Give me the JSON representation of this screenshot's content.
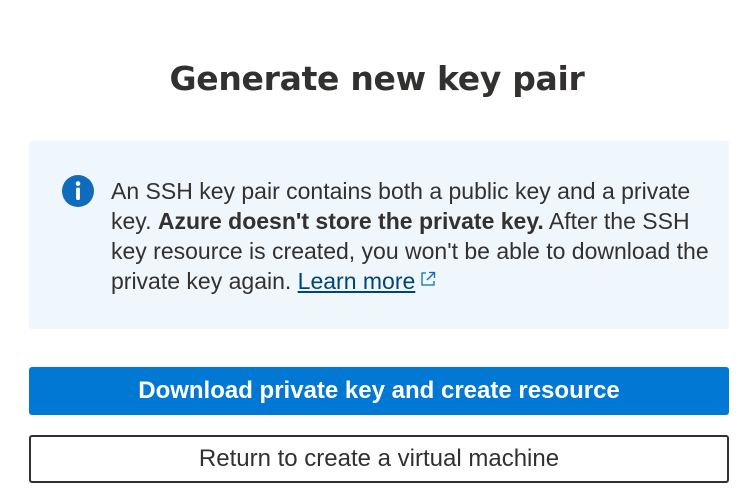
{
  "dialog": {
    "title": "Generate new key pair"
  },
  "info": {
    "icon": "info-icon",
    "accent_color": "#0f6cbd",
    "background_color": "#eff6fc",
    "text_intro": "An SSH key pair contains both a public key and a private key. ",
    "text_bold": "Azure doesn't store the private key.",
    "text_rest": " After the SSH key resource is created, you won't be able to download the private key again. ",
    "learn_more_label": "Learn more",
    "learn_more_icon": "external-link-icon"
  },
  "actions": {
    "primary_label": "Download private key and create resource",
    "primary_color": "#0078d4",
    "secondary_label": "Return to create a virtual machine"
  }
}
